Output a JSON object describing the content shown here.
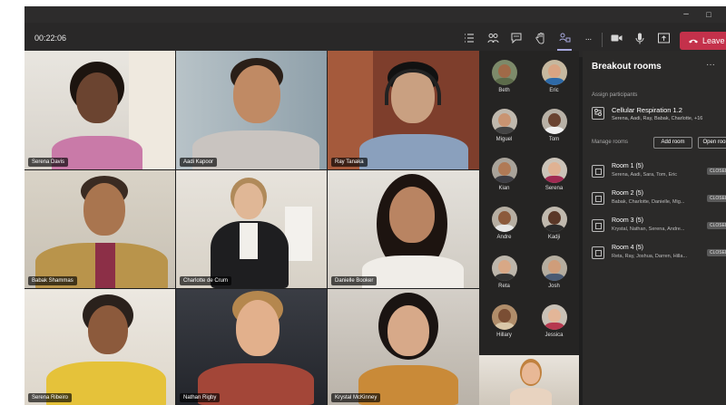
{
  "window": {
    "minimize_glyph": "–",
    "maximize_glyph": "□"
  },
  "toolbar": {
    "timer": "00:22:06",
    "icons": [
      "participants-list-icon",
      "people-icon",
      "chat-icon",
      "raise-hand-icon",
      "breakout-rooms-icon",
      "more-icon",
      "camera-icon",
      "mic-icon",
      "share-icon"
    ],
    "more_glyph": "···",
    "leave_label": "Leave",
    "leave_color": "#c4314b",
    "active_color": "#a6a7dc"
  },
  "tiles": [
    {
      "name": "Serena Davis"
    },
    {
      "name": "Aadi Kapoor"
    },
    {
      "name": "Ray Tanaka"
    },
    {
      "name": "Babak Shammas"
    },
    {
      "name": "Charlotte de Crum"
    },
    {
      "name": "Danielle Booker"
    },
    {
      "name": "Serena Ribeiro"
    },
    {
      "name": "Nathan Rigby"
    },
    {
      "name": "Krystal McKinney"
    }
  ],
  "roster": [
    "Beth",
    "Eric",
    "Miguel",
    "Tom",
    "Kian",
    "Serena",
    "Andre",
    "Kadji",
    "Reta",
    "Josh",
    "Hillary",
    "Jessica"
  ],
  "panel": {
    "title": "Breakout rooms",
    "more_glyph": "···",
    "assign_label": "Assign participants",
    "assign_title": "Cellular Respiration 1.2",
    "assign_names": "Serena, Aadi, Ray, Babak, Charlotte, +16",
    "manage_label": "Manage rooms",
    "add_room": "Add room",
    "open_rooms": "Open rooms",
    "rooms": [
      {
        "title": "Room 1 (5)",
        "names": "Serena, Aadi, Sara, Tom, Eric",
        "status": "CLOSED"
      },
      {
        "title": "Room 2 (5)",
        "names": "Babak, Charlotte, Danielle, Mig...",
        "status": "CLOSED"
      },
      {
        "title": "Room 3 (5)",
        "names": "Krystal, Nathan, Serena, Andre...",
        "status": "CLOSED"
      },
      {
        "title": "Room 4 (5)",
        "names": "Reta, Ray, Joshua, Darren, Hilla...",
        "status": "CLOSED"
      }
    ]
  }
}
